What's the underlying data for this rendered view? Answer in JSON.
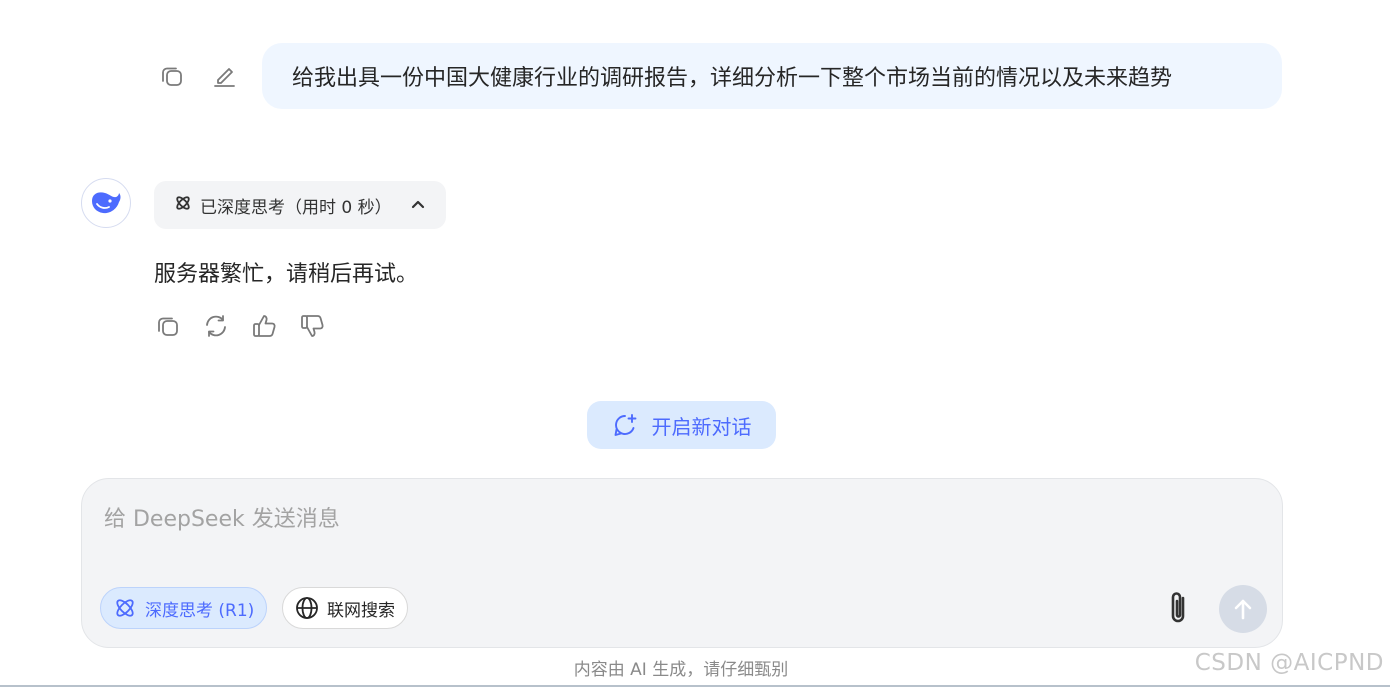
{
  "user_message": {
    "text": "给我出具一份中国大健康行业的调研报告，详细分析一下整个市场当前的情况以及未来趋势",
    "actions": [
      "copy-icon",
      "edit-icon"
    ]
  },
  "assistant": {
    "avatar_icon": "deepseek-whale-icon",
    "think_chip_label": "已深度思考（用时 0 秒）",
    "reply_text": "服务器繁忙，请稍后再试。",
    "actions": [
      "copy-icon",
      "regenerate-icon",
      "thumbs-up-icon",
      "thumbs-down-icon"
    ]
  },
  "new_chat": {
    "label": "开启新对话"
  },
  "composer": {
    "placeholder": "给 DeepSeek 发送消息",
    "deep_think_label": "深度思考 (R1)",
    "web_search_label": "联网搜索"
  },
  "footer": {
    "disclaimer": "内容由 AI 生成，请仔细甄别",
    "watermark": "CSDN @AICPND"
  },
  "colors": {
    "accent": "#4d6bfe",
    "user_bubble": "#eff6ff",
    "chip_bg": "#f3f4f6",
    "send_disabled": "#d6dce6"
  }
}
